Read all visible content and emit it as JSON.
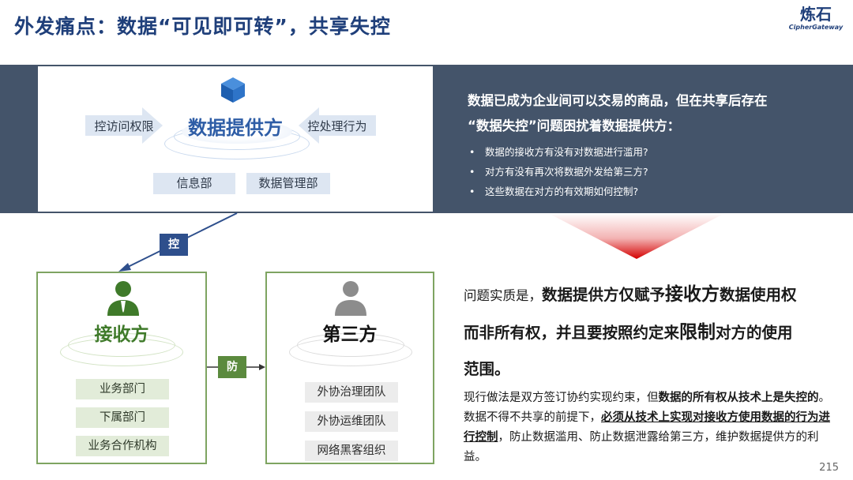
{
  "header": {
    "title": "外发痛点：数据“可见即可转”，共享失控"
  },
  "logo": {
    "name": "炼石",
    "subtitle": "CipherGateway"
  },
  "provider": {
    "title": "数据提供方",
    "left_arrow_label": "控访问权限",
    "right_arrow_label": "控处理行为",
    "departments": [
      "信息部",
      "数据管理部"
    ]
  },
  "issue": {
    "headline_line1": "数据已成为企业间可以交易的商品，但在共享后存在",
    "headline_line2": "“数据失控”问题困扰着数据提供方：",
    "bullets": [
      "数据的接收方有没有对数据进行滥用?",
      "对方有没有再次将数据外发给第三方?",
      "这些数据在对方的有效期如何控制?"
    ]
  },
  "tags": {
    "control": "控",
    "defend": "防"
  },
  "receiver": {
    "title": "接收方",
    "items": [
      "业务部门",
      "下属部门",
      "业务合作机构"
    ]
  },
  "third_party": {
    "title": "第三方",
    "items": [
      "外协治理团队",
      "外协运维团队",
      "网络黑客组织"
    ]
  },
  "essence": {
    "lead": "问题实质是，",
    "p1": "数据提供方仅赋予",
    "big1": "接收方",
    "p2": "数据使用权",
    "p3": "而非所有权，并且要按照约定来",
    "big2": "限制",
    "p4": "对方的使用",
    "p5": "范围。"
  },
  "practice": {
    "t1": "现行做法是双方签订协约实现约束，但",
    "b1": "数据的所有权从技术上是失控的",
    "t2": "。数据不得不共享的前提下，",
    "u1": "必须从技术上实现对接收方使用数据的行为进行控制",
    "t3": "，防止数据滥用、防止数据泄露给第三方，维护数据提供方的利益。"
  },
  "page_number": "215",
  "colors": {
    "navy": "#1f3f7a",
    "band": "#44546a",
    "blue": "#2e5da6",
    "green": "#5b8a3e",
    "red": "#c00000"
  }
}
